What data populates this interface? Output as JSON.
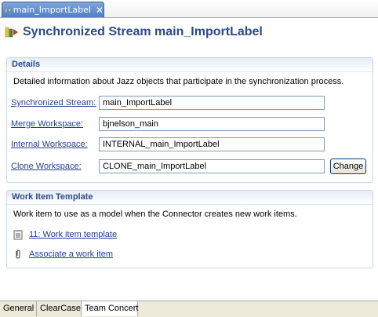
{
  "editor_tab": {
    "label": "main_ImportLabel",
    "close_glyph": "✕",
    "icon": "sync-stream-icon"
  },
  "header": {
    "title": "Synchronized Stream main_ImportLabel",
    "icon": "sync-stream-icon"
  },
  "details": {
    "heading": "Details",
    "description": "Detailed information about Jazz objects that participate in the synchronization process.",
    "fields": [
      {
        "label": "Synchronized Stream:",
        "value": "main_ImportLabel"
      },
      {
        "label": "Merge Workspace:",
        "value": "bjnelson_main"
      },
      {
        "label": "Internal Workspace:",
        "value": "INTERNAL_main_ImportLabel"
      },
      {
        "label": "Clone Workspace:",
        "value": "CLONE_main_ImportLabel"
      }
    ],
    "change_label": "Change"
  },
  "work_item_template": {
    "heading": "Work Item Template",
    "description": "Work item to use as a model when the Connector creates new work items.",
    "template_link": "11: Work item template",
    "associate_link": "Associate a work item"
  },
  "bottom_tabs": [
    {
      "label": "General"
    },
    {
      "label": "ClearCase"
    },
    {
      "label": "Team Concert"
    }
  ],
  "colors": {
    "title": "#2a4a8a",
    "section_header": "#2a4a8a",
    "link": "#1f3b9c",
    "tab_active_bg": "#4f7fc6"
  }
}
